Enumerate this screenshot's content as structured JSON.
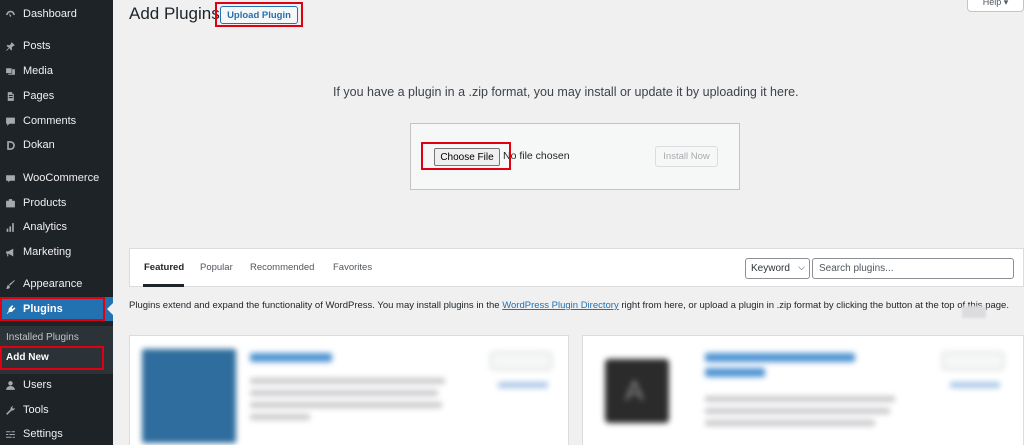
{
  "sidebar": {
    "items": [
      {
        "label": "Dashboard",
        "icon": "dashboard-icon"
      },
      {
        "label": "Posts",
        "icon": "pin-icon"
      },
      {
        "label": "Media",
        "icon": "media-icon"
      },
      {
        "label": "Pages",
        "icon": "pages-icon"
      },
      {
        "label": "Comments",
        "icon": "comments-icon"
      },
      {
        "label": "Dokan",
        "icon": "dokan-icon"
      },
      {
        "label": "WooCommerce",
        "icon": "woocommerce-icon"
      },
      {
        "label": "Products",
        "icon": "products-icon"
      },
      {
        "label": "Analytics",
        "icon": "analytics-icon"
      },
      {
        "label": "Marketing",
        "icon": "megaphone-icon"
      },
      {
        "label": "Appearance",
        "icon": "brush-icon"
      },
      {
        "label": "Plugins",
        "icon": "plugin-icon"
      },
      {
        "label": "Users",
        "icon": "users-icon"
      },
      {
        "label": "Tools",
        "icon": "wrench-icon"
      },
      {
        "label": "Settings",
        "icon": "settings-icon"
      }
    ],
    "submenu": [
      "Installed Plugins",
      "Add New"
    ]
  },
  "header": {
    "title": "Add Plugins",
    "upload_button": "Upload Plugin",
    "help": "Help ▾"
  },
  "upload": {
    "help_text": "If you have a plugin in a .zip format, you may install or update it by uploading it here.",
    "choose_file": "Choose File",
    "no_file": "No file chosen",
    "install_now": "Install Now"
  },
  "filter": {
    "tabs": [
      "Featured",
      "Popular",
      "Recommended",
      "Favorites"
    ],
    "keyword": "Keyword",
    "search_placeholder": "Search plugins..."
  },
  "description": {
    "before": "Plugins extend and expand the functionality of WordPress. You may install plugins in the ",
    "link": "WordPress Plugin Directory",
    "after": " right from here, or upload a plugin in .zip format by clicking the button at the top of this page."
  },
  "colors": {
    "sidebar_bg": "#1d2327",
    "accent": "#2271b1",
    "highlight_box": "#e1000f",
    "page_bg": "#f0f0f1"
  }
}
